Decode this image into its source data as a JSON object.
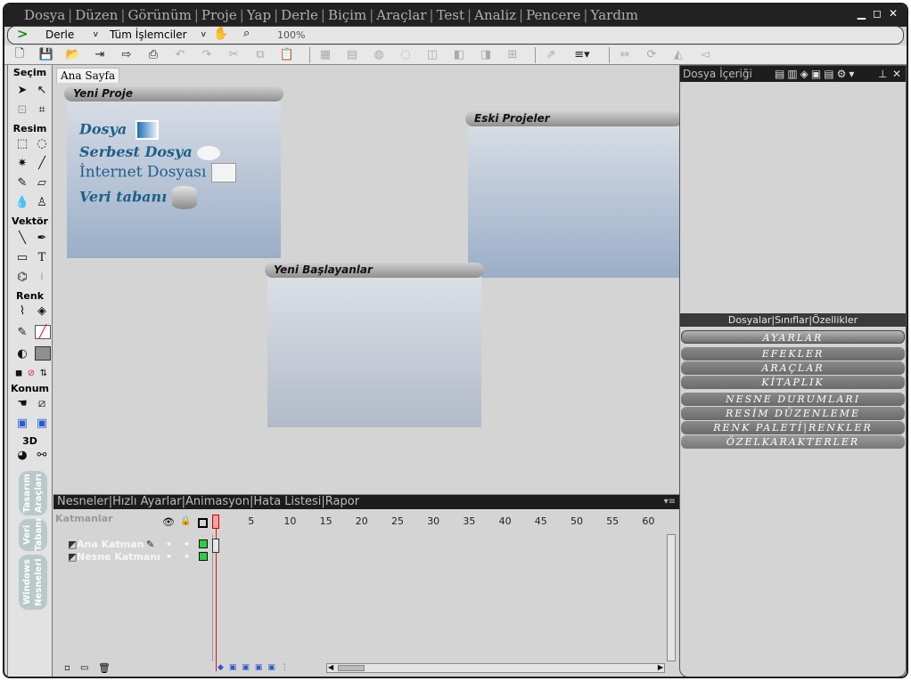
{
  "menu": [
    "Dosya",
    "Düzen",
    "Görünüm",
    "Proje",
    "Yap",
    "Derle",
    "Biçim",
    "Araçlar",
    "Test",
    "Analiz",
    "Pencere",
    "Yardım"
  ],
  "window_controls": {
    "minimize": "▁",
    "restore": "◻",
    "close": "✕"
  },
  "run_bar": {
    "build_label": "Derle",
    "processors_label": "Tüm İşlemciler",
    "zoom": "100%"
  },
  "tools": {
    "sections": [
      "Seçim",
      "Resim",
      "Vektör",
      "Renk",
      "Konum",
      "3D"
    ],
    "side_tabs": [
      "Tasarım Araçları",
      "Veri Tabanı",
      "Windows Nesneleri"
    ]
  },
  "workspace": {
    "tab": "Ana Sayfa",
    "new_project": {
      "title": "Yeni Proje",
      "links": [
        "Dosya",
        "Serbest Dosya",
        "İnternet Dosyası",
        "Veri tabanı"
      ]
    },
    "old_projects": {
      "title": "Eski Projeler"
    },
    "beginners": {
      "title": "Yeni Başlayanlar"
    }
  },
  "right_panel": {
    "title": "Dosya İçeriği",
    "tabs": "Dosyalar|Sınıflar|Özellikler",
    "accordion": [
      "AYARLAR",
      "EFEKLER",
      "ARAÇLAR",
      "KİTAPLIK",
      "NESNE DURUMLARI",
      "RESİM DÜZENLEME",
      "RENK PALETİ|RENKLER",
      "ÖZELKARAKTERLER"
    ]
  },
  "timeline": {
    "tabs": "Nesneler|Hızlı Ayarlar|Animasyon|Hata Listesi|Rapor",
    "layers_label": "Katmanlar",
    "ruler": [
      "1",
      "5",
      "10",
      "15",
      "20",
      "25",
      "30",
      "35",
      "40",
      "45",
      "50",
      "55",
      "60"
    ],
    "layers": [
      "Ana Katman",
      "Nesne Katmanı"
    ],
    "playhead_frame": 1
  }
}
